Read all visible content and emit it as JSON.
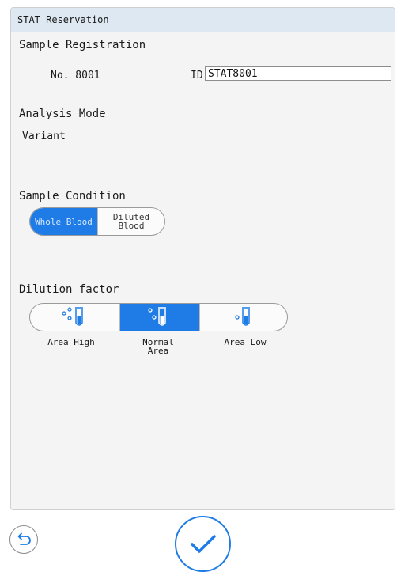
{
  "window": {
    "title": "STAT Reservation"
  },
  "registration": {
    "heading": "Sample Registration",
    "number_text": "No. 8001",
    "id_label": "ID",
    "id_value": "STAT8001"
  },
  "analysis": {
    "heading": "Analysis Mode",
    "value": "Variant"
  },
  "condition": {
    "heading": "Sample Condition",
    "options": [
      {
        "label_line1": "Whole Blood",
        "label_line2": "",
        "selected": true
      },
      {
        "label_line1": "Diluted",
        "label_line2": "Blood",
        "selected": false
      }
    ]
  },
  "dilution": {
    "heading": "Dilution factor",
    "options": [
      {
        "label": "Area High",
        "drops": 3,
        "icon": "tube-three-drops-icon",
        "selected": false
      },
      {
        "label": "Normal\nArea",
        "drops": 2,
        "icon": "tube-two-drops-icon",
        "selected": true
      },
      {
        "label": "Area Low",
        "drops": 1,
        "icon": "tube-one-drop-icon",
        "selected": false
      }
    ]
  },
  "footer": {
    "back_icon": "undo-arrow-icon",
    "confirm_icon": "checkmark-icon"
  },
  "colors": {
    "accent": "#1f7ce6",
    "titlebar": "#dde8f3",
    "panel": "#f4f4f4"
  }
}
